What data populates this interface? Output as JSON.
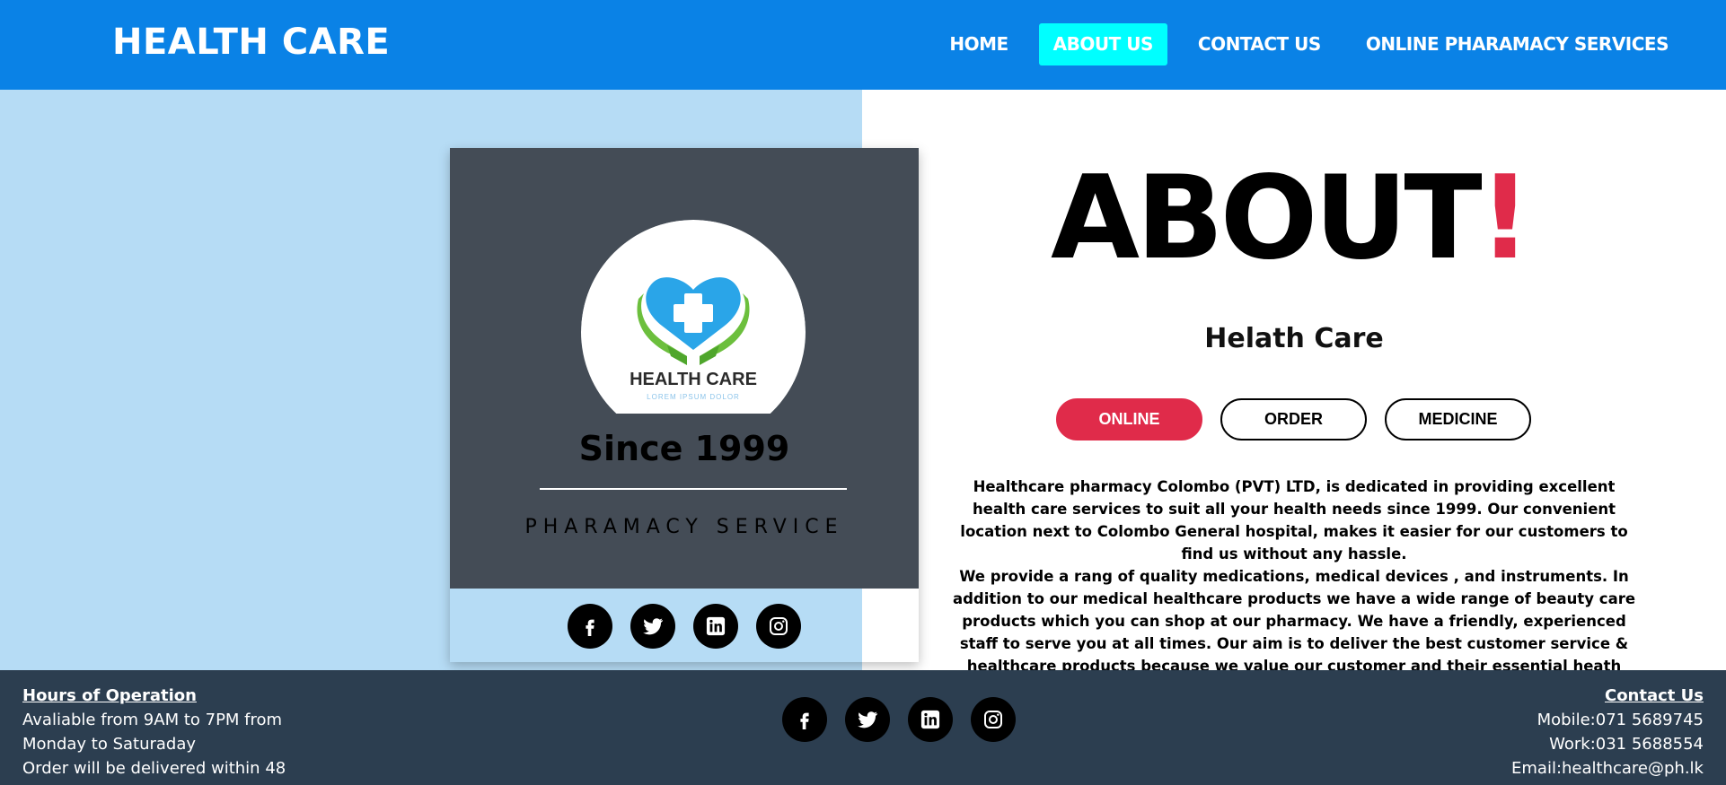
{
  "header": {
    "brand": "HEALTH CARE",
    "nav": [
      {
        "label": "HOME",
        "active": false
      },
      {
        "label": "ABOUT US",
        "active": true
      },
      {
        "label": "CONTACT US",
        "active": false
      },
      {
        "label": "ONLINE PHARAMACY SERVICES",
        "active": false
      }
    ]
  },
  "card": {
    "logo_text": "HEALTH CARE",
    "logo_tagline": "LOREM IPSUM DOLOR",
    "since": "Since 1999",
    "service": "PHARAMACY SERVICE",
    "social_icons": [
      "facebook-icon",
      "twitter-icon",
      "linkedin-icon",
      "instagram-icon"
    ]
  },
  "about": {
    "title": "ABOUT",
    "title_bang": "!",
    "subtitle": "Helath Care",
    "pills": [
      "ONLINE",
      "ORDER",
      "MEDICINE"
    ],
    "description_1": "Healthcare pharmacy Colombo (PVT) LTD, is dedicated in providing excellent health care services to suit all your health needs since 1999. Our convenient location next to Colombo General hospital, makes it easier for our customers to find us without any hassle.",
    "description_2": "We provide a rang of quality medications, medical devices , and instruments. In addition to our medical healthcare products we have a wide range of beauty care products which you can shop at our pharmacy. We have a friendly, experienced staff to serve you at all times. Our aim is to deliver the best customer service & healthcare products because we value our customer and their essential heath needs as our first priority."
  },
  "footer": {
    "hours_title": "Hours of Operation",
    "hours_line1": "Avaliable from 9AM to 7PM from",
    "hours_line2": "Monday to Saturaday",
    "hours_line3": "Order will be delivered within 48",
    "contact_title": "Contact Us",
    "mobile": "Mobile:071 5689745",
    "work": "Work:031 5688554",
    "email": "Email:healthcare@ph.lk"
  },
  "colors": {
    "header_bg": "#0a82e6",
    "active_nav": "#00ffff",
    "left_bg": "#b6dcf5",
    "card_dark": "#444c56",
    "accent_red": "#e02b4a",
    "footer_bg": "#2c3e50"
  }
}
